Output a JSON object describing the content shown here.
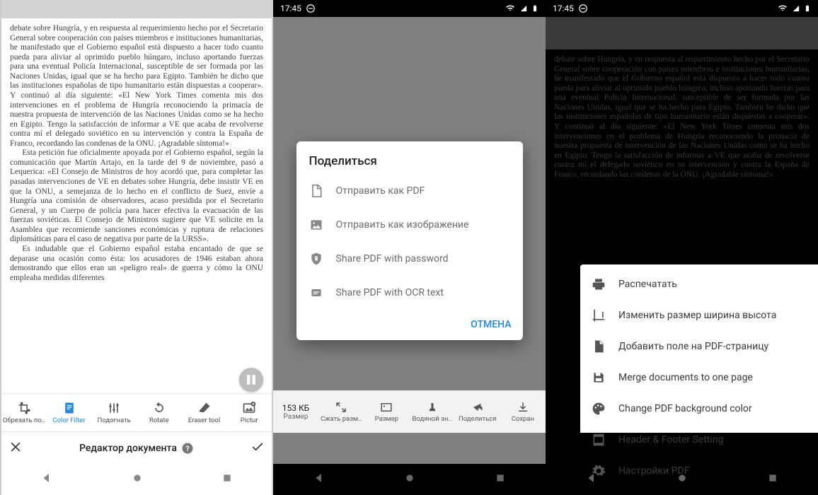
{
  "status": {
    "time": "17:45"
  },
  "doc": {
    "p1": "debate sobre Hungría, y en respuesta al requerimiento hecho por el Secretario General sobre cooperación con países miembros e instituciones humanitarias, he manifestado que el Gobierno español está dispuesto a hacer todo cuanto pueda para aliviar al oprimido pueblo húngaro, incluso aportando fuerzas para una eventual Policía Internacional, susceptible de ser formada por las Naciones Unidas, igual que se ha hecho para Egipto. También he dicho que las instituciones españolas de tipo humanitario están dispuestas a cooperar». Y continuó al día siguiente: «El New York Times comenta mis dos intervenciones en el problema de Hungría reconociendo la primacía de nuestra propuesta de intervención de las Naciones Unidas como se ha hecho en Egipto. Tengo la satisfacción de informar a VE que acaba de revolverse contra mí el delegado soviético en su intervención y contra la España de Franco, recordando las condenas de la ONU. ¡Agradable síntoma!»",
    "p2": "Esta petición fue oficialmente apoyada por el Gobierno español, según la comunicación que Martín Artajo, en la tarde del 9 de noviembre, pasó a Lequerica: «El Consejo de Ministros de hoy acordó que, para completar las pasadas intervenciones de VE en debates sobre Hungría, debe insistir VE en que la ONU, a semejanza de lo hecho en el conflicto de Suez, envíe a Hungría una comisión de observadores, acaso presidida por el Secretario General, y un Cuerpo de policía para hacer efectiva la evacuación de las fuerzas soviéticas. El Consejo de Ministros sugiere que VE solicite en la Asamblea que recomiende sanciones económicas y ruptura de relaciones diplomáticas para el caso de negativa por parte de la URSS».",
    "p3": "Es indudable que el Gobierno español estaba encantado de que se deparase una ocasión como ésta: los acusadores de 1946 estaban ahora demostrando que ellos eran un «peligro real» de guerra y cómo la ONU empleaba medidas diferentes"
  },
  "toolbar": {
    "crop": "Обрезать по..",
    "color": "Color Filter",
    "fit": "Подогнать",
    "rotate": "Rotate",
    "eraser": "Eraser tool",
    "picture": "Pictur"
  },
  "editor": {
    "title": "Редактор документа"
  },
  "dialog": {
    "title": "Поделиться",
    "send_pdf": "Отправить как PDF",
    "send_img": "Отправить как изображение",
    "pdf_pw": "Share PDF with password",
    "pdf_ocr": "Share PDF with OCR text",
    "cancel": "ОТМЕНА"
  },
  "bottombar": {
    "size_val": "153 КБ",
    "size_lbl": "Размер",
    "compress": "Сжать разм..",
    "size": "Размер",
    "watermark": "Водяной зн..",
    "share": "Поделиться",
    "save": "Сохран"
  },
  "menu": {
    "print": "Распечатать",
    "resize": "Изменить размер ширина высота",
    "addfield": "Добавить поле на PDF-страницу",
    "merge": "Merge documents to one page",
    "bgcolor": "Change PDF background color",
    "headfoot": "Header & Footer Setting",
    "settings": "Настройки PDF"
  }
}
